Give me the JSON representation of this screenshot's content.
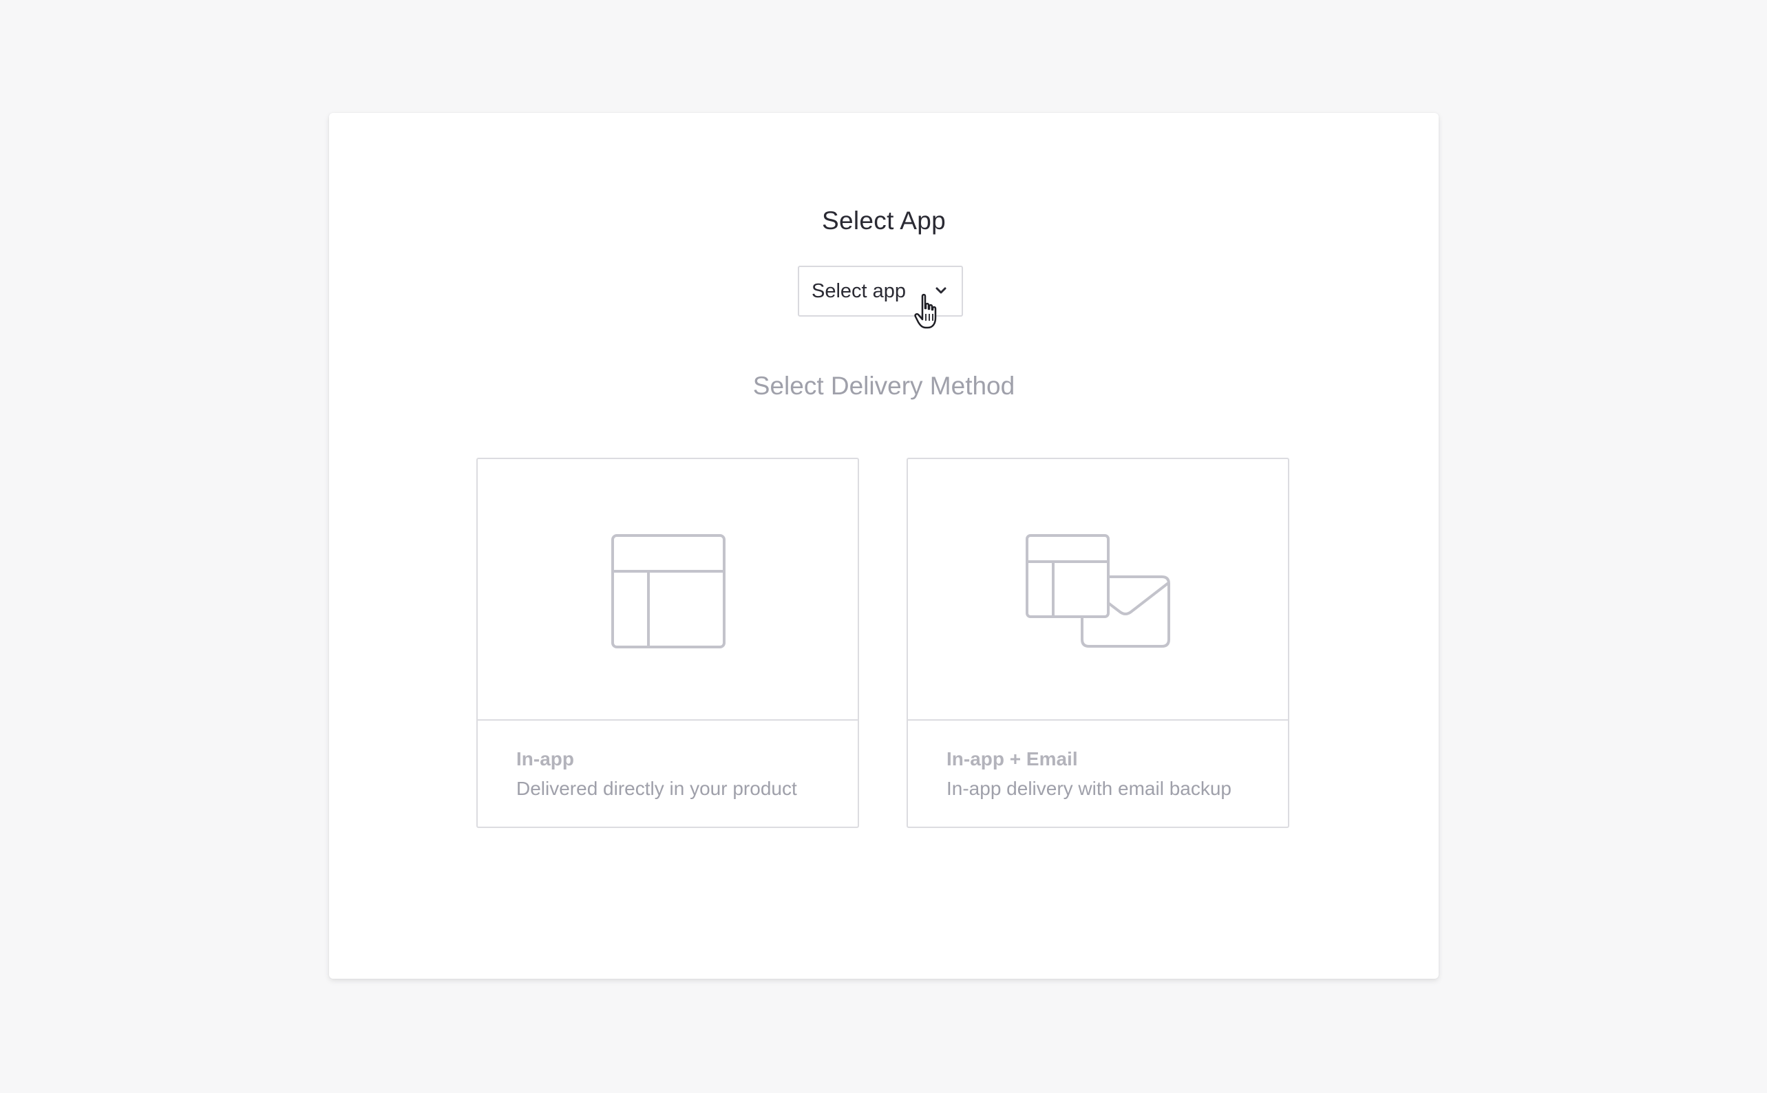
{
  "page": {
    "title": "Select App",
    "app_select": {
      "value": "Select app",
      "icon": "chevron-down-icon"
    },
    "subtitle": "Select Delivery Method",
    "delivery_methods": [
      {
        "icon": "layout-icon",
        "title": "In-app",
        "description": "Delivered directly in your product"
      },
      {
        "icon": "layout-email-icon",
        "title": "In-app + Email",
        "description": "In-app delivery with email backup"
      }
    ]
  },
  "colors": {
    "background": "#f7f7f8",
    "panel": "#ffffff",
    "title_text": "#2a2a33",
    "muted_text": "#9fa0aa",
    "icon_stroke": "#c3c3cb",
    "border": "#dcdce0"
  }
}
